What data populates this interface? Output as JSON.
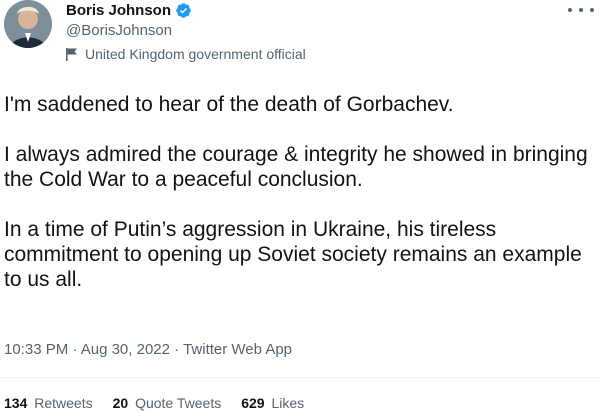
{
  "author": {
    "display_name": "Boris Johnson",
    "handle": "@BorisJohnson",
    "label": "United Kingdom government official",
    "verified": true
  },
  "tweet": {
    "paragraphs": [
      "I'm saddened to hear of the death of Gorbachev.",
      "I always admired the courage & integrity he showed in bringing the Cold War to a peaceful conclusion.",
      "In a time of Putin’s aggression in Ukraine, his tireless commitment to opening up Soviet society remains an example to us all."
    ]
  },
  "meta": {
    "time": "10:33 PM",
    "date": "Aug 30, 2022",
    "source": "Twitter Web App"
  },
  "stats": {
    "retweets_count": "134",
    "retweets_label": "Retweets",
    "quote_tweets_count": "20",
    "quote_tweets_label": "Quote Tweets",
    "likes_count": "629",
    "likes_label": "Likes"
  },
  "colors": {
    "verified": "#1d9bf0",
    "text": "#0f1419",
    "secondary": "#536471"
  },
  "icons": {
    "verified": "verified-badge-icon",
    "label": "flag-icon",
    "more": "more-options-icon"
  }
}
